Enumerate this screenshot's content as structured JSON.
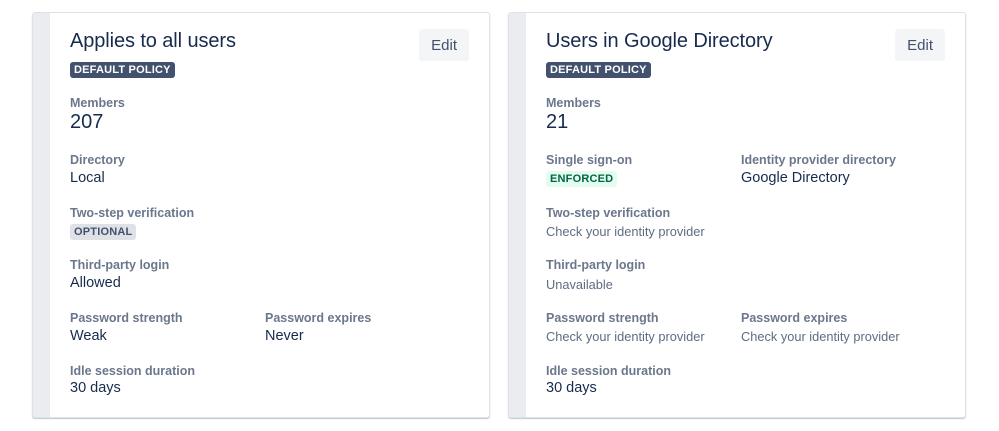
{
  "cards": [
    {
      "title": "Applies to all users",
      "badge": "DEFAULT POLICY",
      "edit_label": "Edit",
      "members_label": "Members",
      "members_value": "207",
      "directory_label": "Directory",
      "directory_value": "Local",
      "two_step_label": "Two-step verification",
      "two_step_value": "OPTIONAL",
      "third_party_label": "Third-party login",
      "third_party_value": "Allowed",
      "password_strength_label": "Password strength",
      "password_strength_value": "Weak",
      "password_expires_label": "Password expires",
      "password_expires_value": "Never",
      "idle_label": "Idle session duration",
      "idle_value": "30 days"
    },
    {
      "title": "Users in Google Directory",
      "badge": "DEFAULT POLICY",
      "edit_label": "Edit",
      "members_label": "Members",
      "members_value": "21",
      "sso_label": "Single sign-on",
      "sso_value": "ENFORCED",
      "idp_label": "Identity provider directory",
      "idp_value": "Google Directory",
      "two_step_label": "Two-step verification",
      "two_step_value": "Check your identity provider",
      "third_party_label": "Third-party login",
      "third_party_value": "Unavailable",
      "password_strength_label": "Password strength",
      "password_strength_value": "Check your identity provider",
      "password_expires_label": "Password expires",
      "password_expires_value": "Check your identity provider",
      "idle_label": "Idle session duration",
      "idle_value": "30 days"
    }
  ],
  "colors": {
    "badge_dark": "#42526e",
    "enforced_bg": "#e3fcef",
    "enforced_text": "#006644",
    "optional_bg": "#dfe1e6"
  }
}
